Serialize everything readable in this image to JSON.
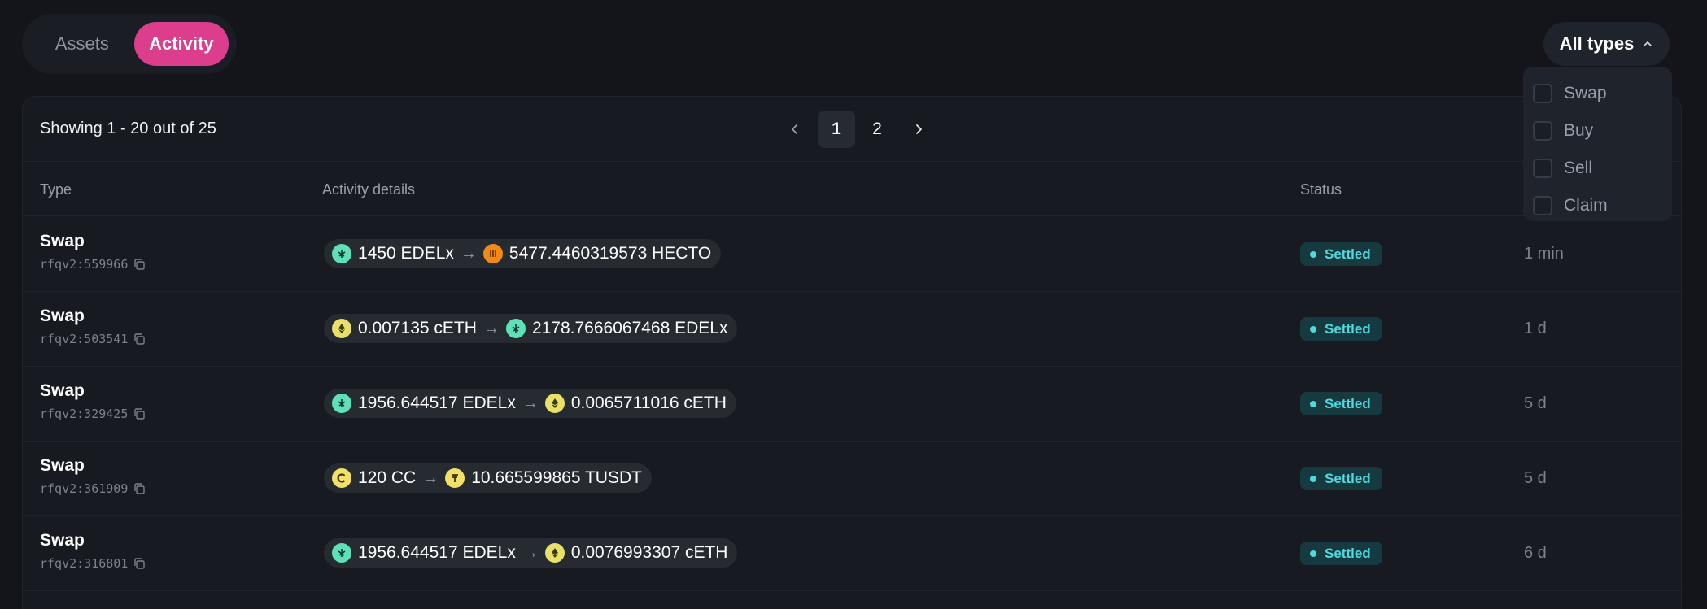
{
  "tabs": [
    {
      "label": "Assets",
      "active": false
    },
    {
      "label": "Activity",
      "active": true
    }
  ],
  "filter": {
    "label": "All types"
  },
  "dropdown": {
    "options": [
      "Swap",
      "Buy",
      "Sell",
      "Claim"
    ]
  },
  "pagination": {
    "showing": "Showing 1 - 20 out of 25",
    "pages": [
      "1",
      "2"
    ],
    "current": "1"
  },
  "table": {
    "headers": {
      "type": "Type",
      "details": "Activity details",
      "status": "Status"
    },
    "rows": [
      {
        "type": "Swap",
        "id": "rfqv2:559966",
        "from": {
          "amount": "1450 EDELx",
          "icon": "edel-token-icon"
        },
        "to": {
          "amount": "5477.4460319573 HECTO",
          "icon": "hecto-token-icon"
        },
        "status": "Settled",
        "time": "1 min"
      },
      {
        "type": "Swap",
        "id": "rfqv2:503541",
        "from": {
          "amount": "0.007135 cETH",
          "icon": "eth-token-icon"
        },
        "to": {
          "amount": "2178.7666067468 EDELx",
          "icon": "edel-token-icon"
        },
        "status": "Settled",
        "time": "1 d"
      },
      {
        "type": "Swap",
        "id": "rfqv2:329425",
        "from": {
          "amount": "1956.644517 EDELx",
          "icon": "edel-token-icon"
        },
        "to": {
          "amount": "0.0065711016 cETH",
          "icon": "eth-token-icon"
        },
        "status": "Settled",
        "time": "5 d"
      },
      {
        "type": "Swap",
        "id": "rfqv2:361909",
        "from": {
          "amount": "120 CC",
          "icon": "cc-token-icon"
        },
        "to": {
          "amount": "10.665599865 TUSDT",
          "icon": "tusdt-token-icon"
        },
        "status": "Settled",
        "time": "5 d"
      },
      {
        "type": "Swap",
        "id": "rfqv2:316801",
        "from": {
          "amount": "1956.644517 EDELx",
          "icon": "edel-token-icon"
        },
        "to": {
          "amount": "0.0076993307 cETH",
          "icon": "eth-token-icon"
        },
        "status": "Settled",
        "time": "6 d"
      }
    ]
  },
  "colors": {
    "accent": "#dc3d8d",
    "settled": "#4fd8dd",
    "background": "#13151b"
  }
}
